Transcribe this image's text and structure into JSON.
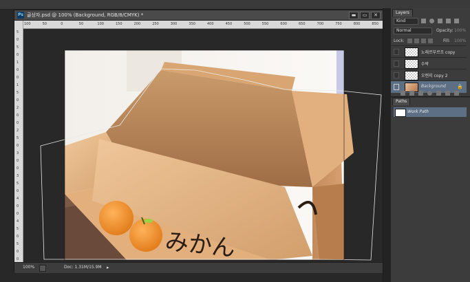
{
  "document": {
    "title": "골상자.psd @ 100% (Background, RGB/8/CMYK) *",
    "zoom": "100%",
    "doc_size": "Doc: 1.31M/15.9M",
    "ruler_h": [
      "100",
      "50",
      "0",
      "50",
      "100",
      "150",
      "200",
      "250",
      "300",
      "350",
      "400",
      "450",
      "500",
      "550",
      "600",
      "650",
      "700",
      "750",
      "800",
      "850"
    ],
    "ruler_v": [
      "5",
      "0",
      "5",
      "0",
      "1",
      "0",
      "0",
      "1",
      "5",
      "0",
      "2",
      "0",
      "0",
      "2",
      "5",
      "0",
      "3",
      "0",
      "0",
      "3",
      "5",
      "0",
      "4",
      "0",
      "0",
      "4",
      "5",
      "0",
      "5",
      "0",
      "0"
    ],
    "artwork_text": "みかん"
  },
  "window_buttons": {
    "minimize": "▬",
    "restore": "▭",
    "close": "✕"
  },
  "layers_panel": {
    "tab": "Layers",
    "filter": "Kind",
    "blend_mode": "Normal",
    "opacity_label": "Opacity:",
    "opacity_value": "100%",
    "lock_label": "Lock:",
    "fill_label": "Fill:",
    "fill_value": "100%",
    "layers": [
      {
        "name": "노래르부르조 copy",
        "thumb": "checker"
      },
      {
        "name": "수박",
        "thumb": "checker"
      },
      {
        "name": "오렌지 copy 2",
        "thumb": "checker"
      },
      {
        "name": "Background",
        "thumb": "photo",
        "locked": true
      }
    ]
  },
  "paths_panel": {
    "tab": "Paths",
    "paths": [
      {
        "name": "Work Path"
      }
    ]
  },
  "colors": {
    "app_bg": "#282828",
    "panel_bg": "#3c3c3c",
    "selection_blue": "#5d6f85",
    "box_light": "#e8b98a",
    "box_mid": "#c58d5c",
    "box_dark": "#a56b3f",
    "orange": "#e88a2a"
  }
}
